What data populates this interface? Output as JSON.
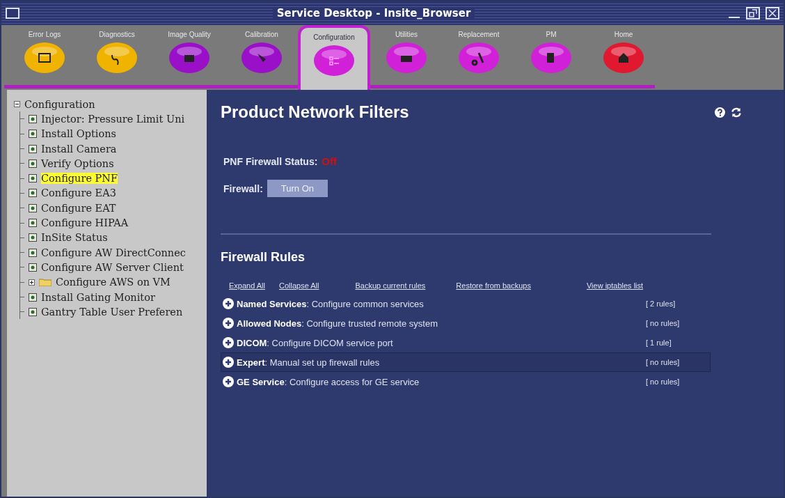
{
  "window": {
    "title": "Service Desktop - Insite_Browser"
  },
  "tabs": [
    {
      "label": "Error Logs",
      "color": "#f0b400",
      "selected": false
    },
    {
      "label": "Diagnostics",
      "color": "#f0b400",
      "selected": false
    },
    {
      "label": "Image Quality",
      "color": "#9a10c8",
      "selected": false
    },
    {
      "label": "Calibration",
      "color": "#9a10c8",
      "selected": false
    },
    {
      "label": "Configuration",
      "color": "#d020d8",
      "selected": true
    },
    {
      "label": "Utilities",
      "color": "#d020d8",
      "selected": false
    },
    {
      "label": "Replacement",
      "color": "#d020d8",
      "selected": false
    },
    {
      "label": "PM",
      "color": "#d020d8",
      "selected": false
    },
    {
      "label": "Home",
      "color": "#e01830",
      "selected": false
    }
  ],
  "tree": {
    "label": "Configuration",
    "expanded": true,
    "children": [
      {
        "label": "Injector: Pressure Limit Uni",
        "kind": "leaf",
        "selected": false
      },
      {
        "label": "Install Options",
        "kind": "leaf",
        "selected": false
      },
      {
        "label": "Install Camera",
        "kind": "leaf",
        "selected": false
      },
      {
        "label": "Verify Options",
        "kind": "leaf",
        "selected": false
      },
      {
        "label": "Configure PNF",
        "kind": "leaf",
        "selected": true
      },
      {
        "label": "Configure EA3",
        "kind": "leaf",
        "selected": false
      },
      {
        "label": "Configure EAT",
        "kind": "leaf",
        "selected": false
      },
      {
        "label": "Configure HIPAA",
        "kind": "leaf",
        "selected": false
      },
      {
        "label": "InSite Status",
        "kind": "leaf",
        "selected": false
      },
      {
        "label": "Configure AW DirectConnec",
        "kind": "leaf",
        "selected": false
      },
      {
        "label": "Configure AW Server Client",
        "kind": "leaf",
        "selected": false
      },
      {
        "label": "Configure AWS on VM",
        "kind": "folder",
        "expanded": false,
        "selected": false
      },
      {
        "label": "Install Gating Monitor",
        "kind": "leaf",
        "selected": false
      },
      {
        "label": "Gantry Table User Preferen",
        "kind": "leaf",
        "selected": false
      }
    ]
  },
  "page": {
    "title": "Product Network Filters",
    "status_label": "PNF Firewall Status:",
    "status_value": "Off",
    "status_on": false,
    "firewall_label": "Firewall:",
    "firewall_button": "Turn On"
  },
  "rules": {
    "title": "Firewall Rules",
    "links": [
      "Expand All",
      "Collapse All",
      "Backup current rules",
      "Restore from backups",
      "View iptables list"
    ],
    "items": [
      {
        "name": "Named Services",
        "description": ": Configure common services",
        "count": "[ 2 rules]",
        "selected": false
      },
      {
        "name": "Allowed Nodes",
        "description": ": Configure trusted remote system",
        "count": "[ no rules]",
        "selected": false
      },
      {
        "name": "DICOM",
        "description": ": Configure DICOM service port",
        "count": "[ 1 rule]",
        "selected": false
      },
      {
        "name": "Expert",
        "description": ": Manual set up firewall rules",
        "count": "[ no rules]",
        "selected": true
      },
      {
        "name": "GE Service",
        "description": ": Configure access for GE service",
        "count": "[ no rules]",
        "selected": false
      }
    ]
  }
}
